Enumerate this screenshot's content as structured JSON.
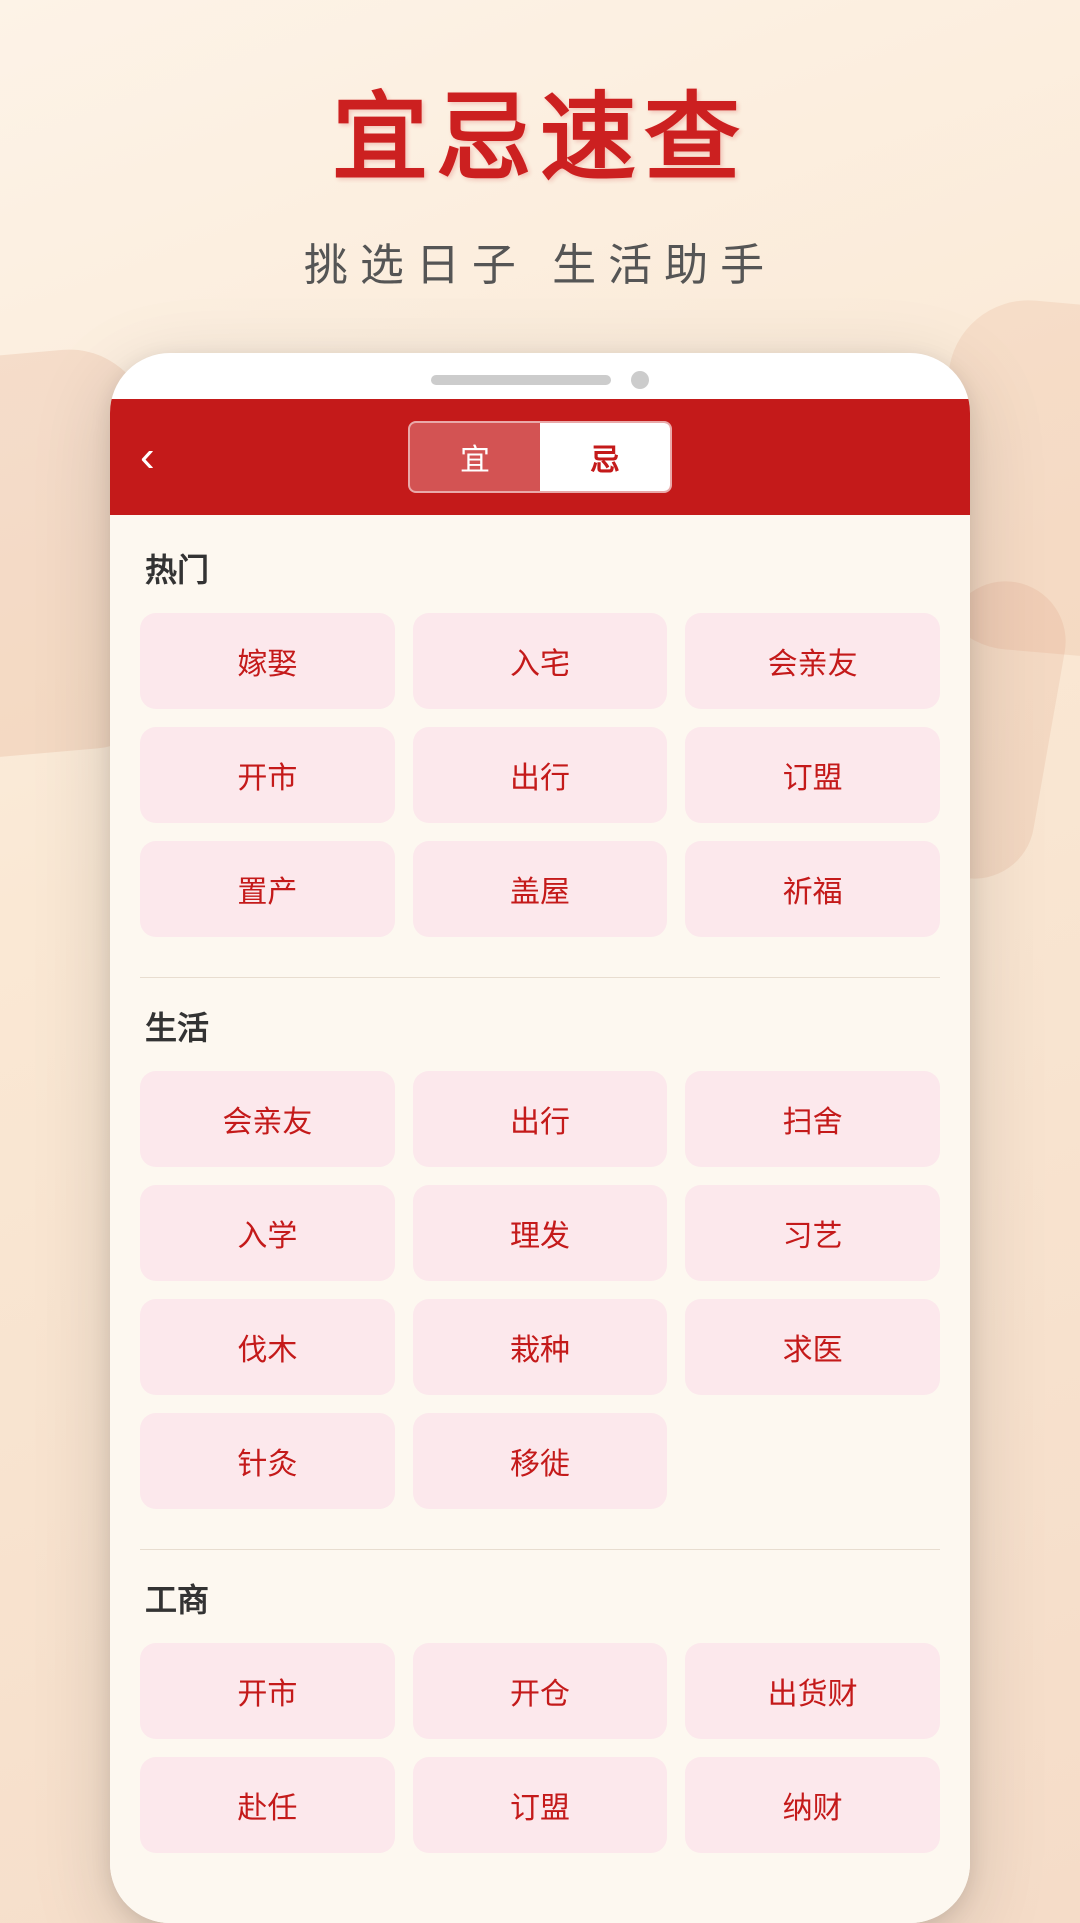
{
  "app": {
    "title": "宜忌速查",
    "subtitle": "挑选日子  生活助手"
  },
  "header": {
    "back_label": "‹",
    "toggle_yi": "宜",
    "toggle_ji": "忌",
    "active_tab": "ji"
  },
  "sections": [
    {
      "id": "hot",
      "title": "热门",
      "items": [
        "嫁娶",
        "入宅",
        "会亲友",
        "开市",
        "出行",
        "订盟",
        "置产",
        "盖屋",
        "祈福"
      ]
    },
    {
      "id": "life",
      "title": "生活",
      "items": [
        "会亲友",
        "出行",
        "扫舍",
        "入学",
        "理发",
        "习艺",
        "伐木",
        "栽种",
        "求医",
        "针灸",
        "移徙"
      ]
    },
    {
      "id": "business",
      "title": "工商",
      "items": [
        "开市",
        "开仓",
        "出货财",
        "赴任",
        "订盟",
        "纳财"
      ]
    }
  ],
  "colors": {
    "primary_red": "#c41a1a",
    "bg_light": "#fdf8f0",
    "item_bg": "#fce8ec",
    "text_dark": "#333333"
  }
}
